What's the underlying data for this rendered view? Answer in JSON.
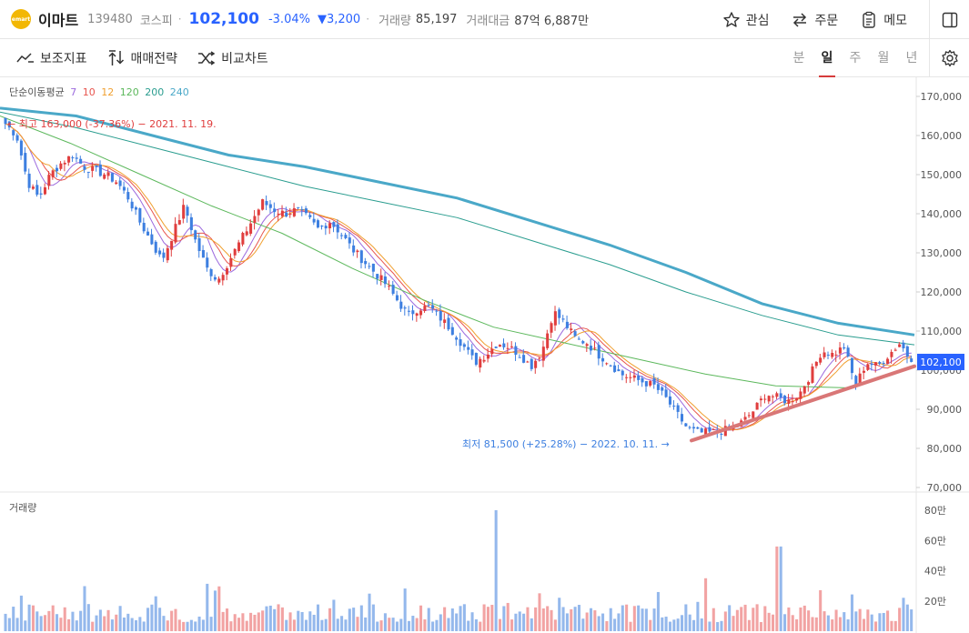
{
  "header": {
    "logo_text": "emart",
    "name": "이마트",
    "code": "139480",
    "market": "코스피",
    "price": "102,100",
    "change_pct": "-3.04%",
    "change_abs": "3,200",
    "volume_label": "거래량",
    "volume": "85,197",
    "amount_label": "거래대금",
    "amount": "87억 6,887만",
    "interest_label": "관심",
    "order_label": "주문",
    "memo_label": "메모"
  },
  "toolbar": {
    "indicators_label": "보조지표",
    "strategy_label": "매매전략",
    "compare_label": "비교차트",
    "periods": [
      "분",
      "일",
      "주",
      "월",
      "년"
    ],
    "active_period": "일"
  },
  "legend": {
    "title": "단순이동평균",
    "items": [
      {
        "label": "7",
        "color": "#9c6ade"
      },
      {
        "label": "10",
        "color": "#e8554e"
      },
      {
        "label": "12",
        "color": "#f0a030"
      },
      {
        "label": "120",
        "color": "#5cb85c"
      },
      {
        "label": "200",
        "color": "#2a9d8f"
      },
      {
        "label": "240",
        "color": "#4aa8c8"
      }
    ],
    "volume_title": "거래량"
  },
  "annotations": {
    "high": "← 최고 163,000 (-37.36%) − 2021. 11. 19.",
    "low": "최저 81,500 (+25.28%) − 2022. 10. 11. →"
  },
  "colors": {
    "up": "#e03e3e",
    "down": "#3d7fe0",
    "price_tag": "#2962ff",
    "trendline": "#d97777"
  },
  "chart_data": {
    "type": "candlestick",
    "ylim": [
      70000,
      170000
    ],
    "y_ticks": [
      "170,000",
      "160,000",
      "150,000",
      "140,000",
      "130,000",
      "120,000",
      "110,000",
      "100,000",
      "90,000",
      "80,000",
      "70,000"
    ],
    "current_price_label": "102,100",
    "volume_ticks": [
      "80만",
      "60만",
      "40만",
      "20만"
    ],
    "high": {
      "value": 163000,
      "date": "2021. 11. 19."
    },
    "low": {
      "value": 81500,
      "date": "2022. 10. 11."
    },
    "close_path": [
      163000,
      160000,
      148000,
      144000,
      150000,
      153000,
      155000,
      152000,
      151000,
      150000,
      148000,
      144000,
      138000,
      133000,
      128000,
      135000,
      142000,
      133000,
      126000,
      123000,
      128000,
      133000,
      138000,
      143000,
      141000,
      140000,
      141000,
      139000,
      136000,
      138000,
      135000,
      131000,
      128000,
      125000,
      122000,
      118000,
      114000,
      116000,
      116000,
      113000,
      110000,
      106000,
      102000,
      104000,
      107000,
      106000,
      104000,
      101000,
      105000,
      115000,
      112000,
      108000,
      107000,
      104000,
      102000,
      99000,
      98000,
      97000,
      96000,
      93000,
      89000,
      85000,
      84000,
      84000,
      84500,
      85000,
      87000,
      90000,
      94000,
      93000,
      92000,
      94000,
      99000,
      105000,
      104000,
      106000,
      96000,
      102000,
      101000,
      104000,
      107000,
      102100
    ],
    "ma_paths": {
      "ma240": [
        167000,
        165000,
        160000,
        155000,
        152000,
        148000,
        144000,
        138000,
        132000,
        125000,
        117000,
        112000,
        109000
      ],
      "ma200": [
        166000,
        162000,
        157000,
        152000,
        147000,
        143000,
        139000,
        133000,
        127000,
        120000,
        114000,
        109000,
        106500
      ],
      "ma120": [
        165000,
        158000,
        150000,
        142000,
        135000,
        126000,
        118000,
        111000,
        107000,
        103000,
        99000,
        96000,
        95500
      ]
    },
    "trendline": [
      [
        82000
      ],
      [
        101000
      ]
    ],
    "volume_max": 800000,
    "volume_spikes": [
      {
        "at": 0.54,
        "value": 800000
      },
      {
        "at": 0.85,
        "value": 560000
      }
    ]
  }
}
